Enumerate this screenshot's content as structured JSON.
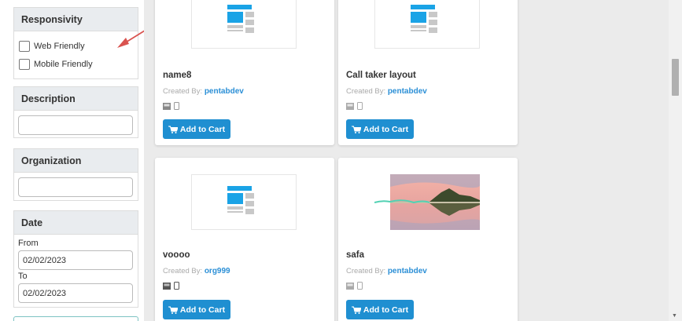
{
  "sidebar": {
    "responsivity": {
      "title": "Responsivity",
      "options": [
        "Web Friendly",
        "Mobile Friendly"
      ]
    },
    "description": {
      "title": "Description",
      "value": ""
    },
    "organization": {
      "title": "Organization",
      "value": ""
    },
    "date": {
      "title": "Date",
      "from_label": "From",
      "from_value": "02/02/2023",
      "to_label": "To",
      "to_value": "02/02/2023"
    }
  },
  "cards": [
    {
      "title": "name8",
      "created_by_label": "Created By:",
      "author": "pentabdev",
      "button": "Add to Cart"
    },
    {
      "title": "Call taker layout",
      "created_by_label": "Created By:",
      "author": "pentabdev",
      "button": "Add to Cart"
    },
    {
      "title": "voooo",
      "created_by_label": "Created By:",
      "author": "org999",
      "button": "Add to Cart"
    },
    {
      "title": "safa",
      "created_by_label": "Created By:",
      "author": "pentabdev",
      "button": "Add to Cart"
    }
  ],
  "colors": {
    "accent": "#1f8fd1",
    "link": "#2b8fd6",
    "annotation_arrow": "#d9534f"
  },
  "icons": [
    "checkbox-icon",
    "layout-thumbnail-icon",
    "desktop-icon",
    "mobile-icon",
    "cart-icon",
    "annotation-arrow-icon"
  ]
}
